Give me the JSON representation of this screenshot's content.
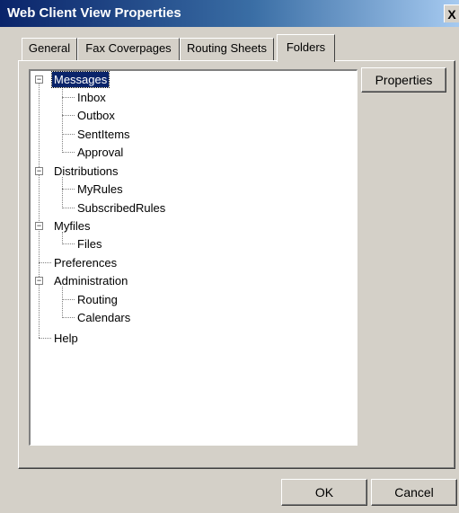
{
  "window": {
    "title": "Web Client View Properties",
    "close_label": "X"
  },
  "tabs": [
    {
      "label": "General"
    },
    {
      "label": "Fax Coverpages"
    },
    {
      "label": "Routing Sheets"
    },
    {
      "label": "Folders"
    }
  ],
  "active_tab": "Folders",
  "tree": {
    "messages": {
      "label": "Messages",
      "expander": "−"
    },
    "inbox": {
      "label": "Inbox"
    },
    "outbox": {
      "label": "Outbox"
    },
    "sentitems": {
      "label": "SentItems"
    },
    "approval": {
      "label": "Approval"
    },
    "distributions": {
      "label": "Distributions",
      "expander": "−"
    },
    "myrules": {
      "label": "MyRules"
    },
    "subscribedrules": {
      "label": "SubscribedRules"
    },
    "myfiles": {
      "label": "Myfiles",
      "expander": "−"
    },
    "files": {
      "label": "Files"
    },
    "preferences": {
      "label": "Preferences"
    },
    "administration": {
      "label": "Administration",
      "expander": "−"
    },
    "routing": {
      "label": "Routing"
    },
    "calendars": {
      "label": "Calendars"
    },
    "help": {
      "label": "Help"
    }
  },
  "buttons": {
    "properties": "Properties",
    "ok": "OK",
    "cancel": "Cancel"
  }
}
